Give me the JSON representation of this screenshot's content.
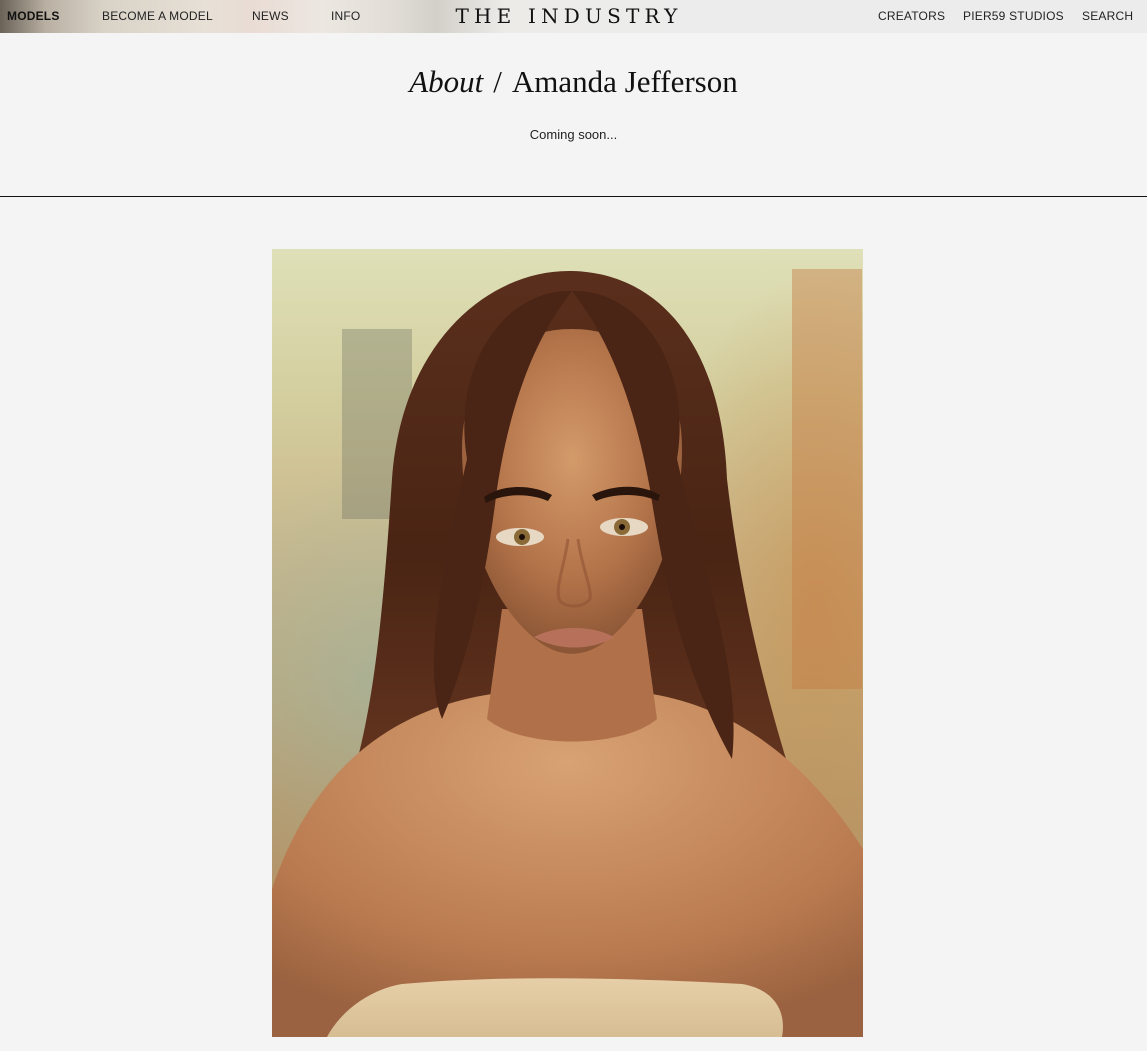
{
  "nav": {
    "left": [
      {
        "label": "MODELS",
        "active": true
      },
      {
        "label": "BECOME A MODEL",
        "active": false
      },
      {
        "label": "NEWS",
        "active": false
      },
      {
        "label": "INFO",
        "active": false
      }
    ],
    "logo": "THE INDUSTRY",
    "right": [
      {
        "label": "CREATORS"
      },
      {
        "label": "PIER59 STUDIOS"
      },
      {
        "label": "SEARCH"
      }
    ]
  },
  "header": {
    "section": "About",
    "separator": "/",
    "name": "Amanda Jefferson",
    "subtitle": "Coming soon..."
  },
  "portrait": {
    "subject": "model-portrait"
  }
}
